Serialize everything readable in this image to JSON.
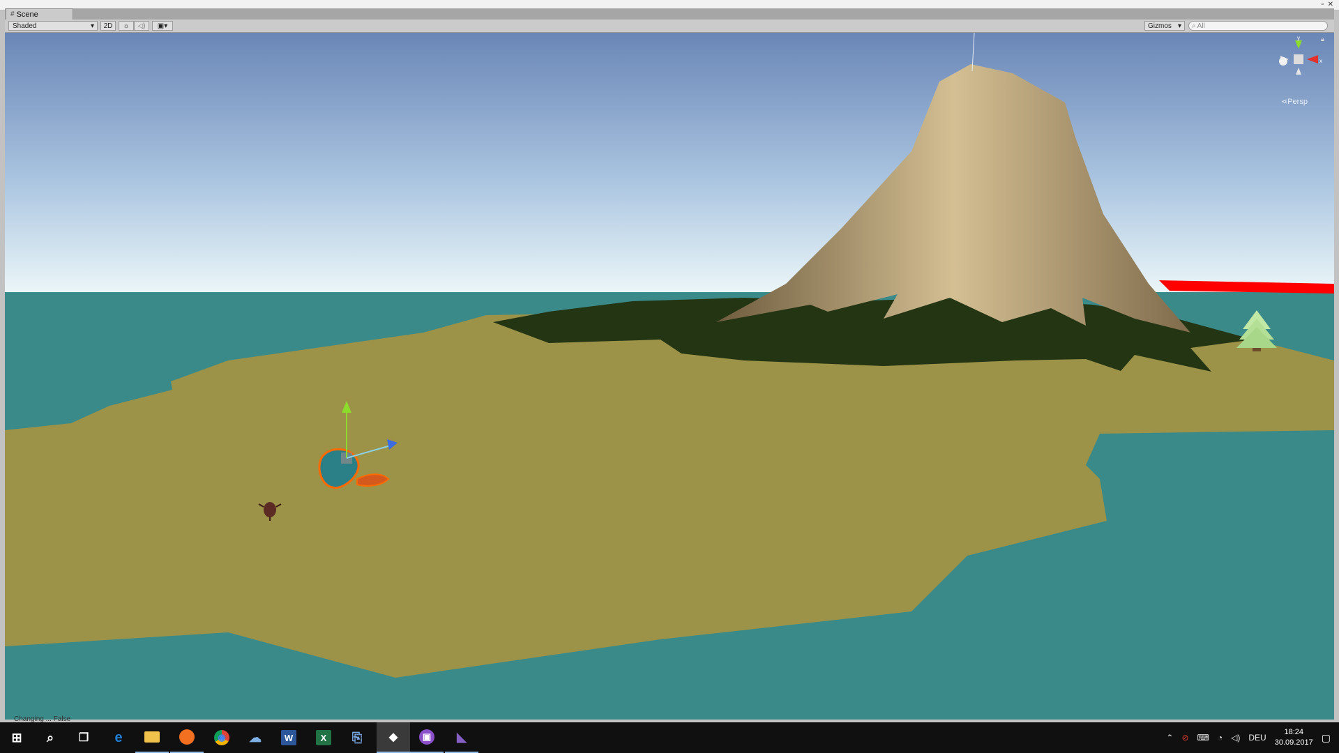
{
  "window": {
    "tab_label": "Scene",
    "maximize_glyph": "▫",
    "close_glyph": "✕"
  },
  "toolbar": {
    "shading_mode": "Shaded",
    "mode_2d_label": "2D",
    "gizmos_label": "Gizmos",
    "search_placeholder": "All",
    "dropdown_glyph": "▾"
  },
  "viewport": {
    "projection_label": "Persp",
    "axis_y": "y",
    "axis_x": "x",
    "colors": {
      "sky_top": "#6a86b6",
      "sky_horizon": "#e6f3f7",
      "ocean": "#3a8a8a",
      "sand": "#9c9248",
      "grass": "#243514",
      "mountain_light": "#c9b48a",
      "mountain_dark": "#7a6646",
      "red_bar": "#ff0000",
      "tree": "#b7e29a",
      "gizmo_y": "#8ddc2b",
      "gizmo_z": "#3a6be0",
      "selection_outline": "#ff6a00"
    }
  },
  "status_bar": {
    "text": "Changing ... False"
  },
  "taskbar": {
    "apps": [
      {
        "name": "start",
        "glyph": "⊞",
        "color": "#ffffff"
      },
      {
        "name": "search",
        "glyph": "⌕",
        "color": "#ffffff"
      },
      {
        "name": "task-view",
        "glyph": "❐",
        "color": "#ffffff"
      },
      {
        "name": "edge",
        "glyph": "e",
        "color": "#1f7ed6"
      },
      {
        "name": "file-explorer",
        "glyph": "▬",
        "color": "#f0c24b"
      },
      {
        "name": "firefox",
        "glyph": "●",
        "color": "#f37021"
      },
      {
        "name": "chrome",
        "glyph": "◉",
        "color": "#e2b42a"
      },
      {
        "name": "app-blue",
        "glyph": "☁",
        "color": "#3f7dc7"
      },
      {
        "name": "word",
        "glyph": "W",
        "color": "#2b579a"
      },
      {
        "name": "excel",
        "glyph": "X",
        "color": "#217346"
      },
      {
        "name": "network-tool",
        "glyph": "⎘",
        "color": "#7aa7e0"
      },
      {
        "name": "unity",
        "glyph": "◆",
        "color": "#ffffff"
      },
      {
        "name": "app-purple",
        "glyph": "▣",
        "color": "#8a4fc9"
      },
      {
        "name": "visual-studio",
        "glyph": "◣",
        "color": "#865fc5"
      }
    ]
  },
  "tray": {
    "chevron": "⌃",
    "lang": "DEU",
    "time": "18:24",
    "date": "30.09.2017",
    "notification_glyph": "▢"
  }
}
